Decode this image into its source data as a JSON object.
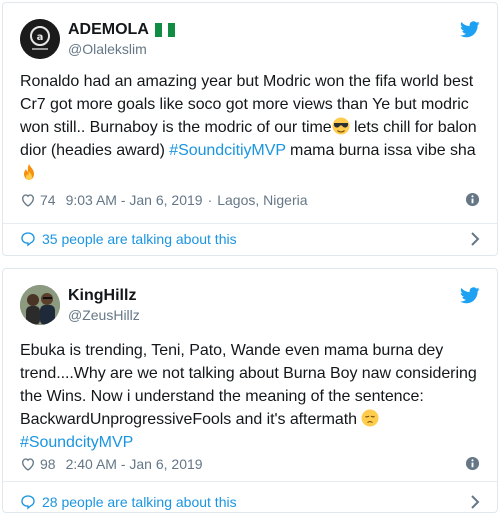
{
  "colors": {
    "link": "#1b95e0",
    "muted": "#657786",
    "text": "#14171a",
    "twitter_blue": "#1da1f2"
  },
  "tweets": [
    {
      "display_name": "ADEMOLA",
      "handle": "@Olalekslim",
      "flag_emoji": "nigeria-flag",
      "text_before": "Ronaldo had an amazing year but Modric won the fifa world best Cr7 got more goals like soco got more views than Ye but modric won still.. Burnaboy is the modric of our time",
      "text_middle": " lets chill for balon dior (headies award) ",
      "hashtag": "#SoundcitiyMVP",
      "text_after": " mama burna issa vibe sha ",
      "emojis": [
        "sunglasses-emoji",
        "fire-emoji"
      ],
      "likes": "74",
      "time": "9:03 AM - Jan 6, 2019",
      "location": "Lagos, Nigeria",
      "talking": "35 people are talking about this"
    },
    {
      "display_name": "KingHillz",
      "handle": "@ZeusHillz",
      "text_before": "Ebuka is trending,  Teni, Pato, Wande even mama burna dey trend....Why are we not talking about Burna Boy naw considering the Wins. Now i understand the meaning of the sentence: BackwardUnprogressiveFools and it's aftermath ",
      "hashtag": "#SoundcityMVP",
      "emojis": [
        "pensive-emoji"
      ],
      "likes": "98",
      "time": "2:40 AM - Jan 6, 2019",
      "talking": "28 people are talking about this"
    }
  ]
}
